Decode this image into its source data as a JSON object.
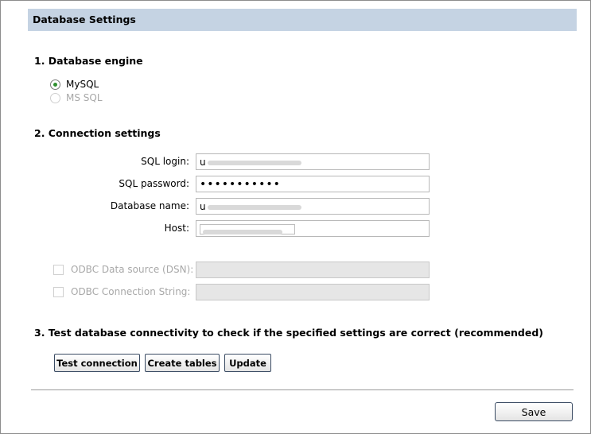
{
  "header": {
    "title": "Database Settings"
  },
  "engine": {
    "title": "1.  Database engine",
    "options": [
      {
        "label": "MySQL",
        "checked": true,
        "disabled": false
      },
      {
        "label": "MS SQL",
        "checked": false,
        "disabled": true
      }
    ]
  },
  "connection": {
    "title": "2.  Connection settings",
    "sql_login_label": "SQL login:",
    "sql_login_value": "u",
    "sql_password_label": "SQL password:",
    "sql_password_value": "•••••••••••",
    "database_name_label": "Database name:",
    "database_name_value": "u",
    "host_label": "Host:"
  },
  "odbc": {
    "dsn_label": "ODBC Data source (DSN):",
    "conn_string_label": "ODBC Connection  String:"
  },
  "test": {
    "title": "3.  Test database connectivity to check if the specified settings are correct (recommended)",
    "test_connection_label": "Test connection",
    "create_tables_label": "Create tables",
    "update_label": "Update"
  },
  "footer": {
    "save_label": "Save"
  }
}
